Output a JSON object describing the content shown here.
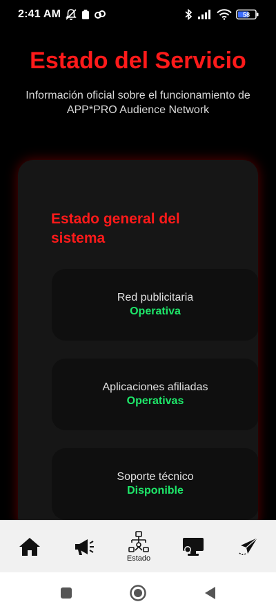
{
  "status_bar": {
    "time": "2:41 AM",
    "battery_label": "58"
  },
  "header": {
    "title": "Estado del Servicio",
    "subtitle": "Información oficial sobre el funcionamiento de APP*PRO Audience Network"
  },
  "card": {
    "title": "Estado general del sistema",
    "items": [
      {
        "label": "Red publicitaria",
        "value": "Operativa"
      },
      {
        "label": "Aplicaciones afiliadas",
        "value": "Operativas"
      },
      {
        "label": "Soporte técnico",
        "value": "Disponible"
      }
    ]
  },
  "bottom_nav": {
    "active_label": "Estado"
  },
  "colors": {
    "accent_red": "#ff1a1a",
    "status_green": "#1ee86a",
    "card_bg": "#161616",
    "item_bg": "#0f0f0f"
  }
}
